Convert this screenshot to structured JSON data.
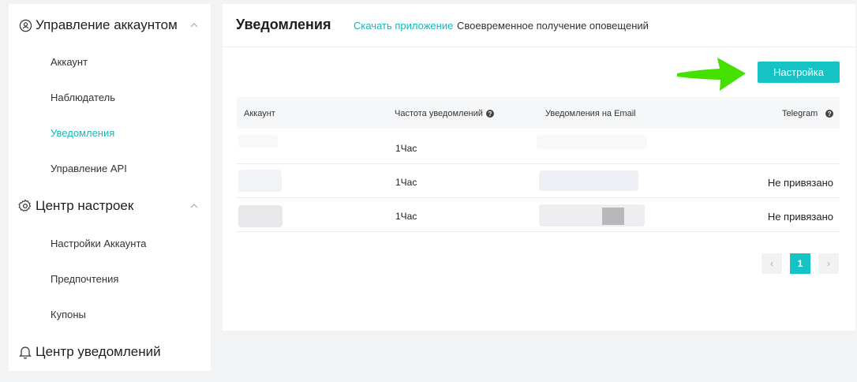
{
  "sidebar": {
    "groups": [
      {
        "label": "Управление аккаунтом",
        "icon": "account-circle-icon",
        "items": [
          {
            "label": "Аккаунт"
          },
          {
            "label": "Наблюдатель"
          },
          {
            "label": "Уведомления",
            "active": true
          },
          {
            "label": "Управление API"
          }
        ]
      },
      {
        "label": "Центр настроек",
        "icon": "gear-icon",
        "items": [
          {
            "label": "Настройки Аккаунта"
          },
          {
            "label": "Предпочтения"
          },
          {
            "label": "Купоны"
          }
        ]
      },
      {
        "label": "Центр уведомлений",
        "icon": "bell-icon",
        "items": []
      }
    ]
  },
  "main": {
    "title": "Уведомления",
    "download_link": "Скачать приложение",
    "download_desc": "Своевременное получение оповещений",
    "settings_button": "Настройка"
  },
  "table": {
    "headers": {
      "account": "Аккаунт",
      "frequency": "Частота уведомлений",
      "email": "Уведомления на Email",
      "telegram": "Telegram"
    },
    "rows": [
      {
        "frequency": "1Час",
        "telegram": ""
      },
      {
        "frequency": "1Час",
        "telegram": "Не привязано"
      },
      {
        "frequency": "1Час",
        "telegram": "Не привязано"
      }
    ]
  },
  "pagination": {
    "prev": "‹",
    "current": "1",
    "next": "›"
  },
  "colors": {
    "accent": "#15c3c4",
    "arrow": "#44e000"
  }
}
